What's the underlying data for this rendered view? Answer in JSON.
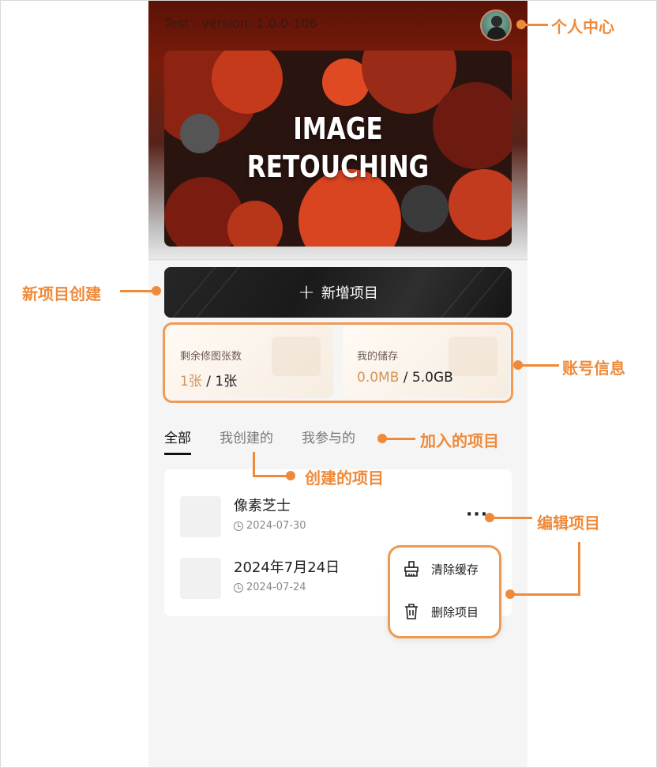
{
  "header": {
    "version_text": "Test - version: 1.0.0-106",
    "avatar_icon": "user-avatar"
  },
  "banner": {
    "line1": "IMAGE",
    "line2": "RETOUCHING"
  },
  "new_project": {
    "icon": "plus-icon",
    "label": "新增项目"
  },
  "account": {
    "remaining": {
      "label": "剩余修图张数",
      "used": "1张",
      "sep": " / ",
      "total": "1张"
    },
    "storage": {
      "label": "我的储存",
      "used": "0.0MB",
      "sep": " / ",
      "total": "5.0GB"
    }
  },
  "tabs": [
    {
      "label": "全部",
      "active": true
    },
    {
      "label": "我创建的",
      "active": false
    },
    {
      "label": "我参与的",
      "active": false
    }
  ],
  "projects": [
    {
      "name": "像素芝士",
      "date": "2024-07-30"
    },
    {
      "name": "2024年7月24日",
      "date": "2024-07-24"
    }
  ],
  "more_icon": "more-dots-icon",
  "menu": [
    {
      "icon": "broom-icon",
      "label": "清除缓存"
    },
    {
      "icon": "trash-icon",
      "label": "删除项目"
    }
  ],
  "callouts": {
    "personal_center": "个人中心",
    "new_project": "新项目创建",
    "account_info": "账号信息",
    "joined_projects": "加入的项目",
    "created_projects": "创建的项目",
    "edit_project": "编辑项目"
  },
  "colors": {
    "accent_orange": "#ef8a3a",
    "value_gold": "#d3955a",
    "header_dark_red": "#5a1206"
  }
}
